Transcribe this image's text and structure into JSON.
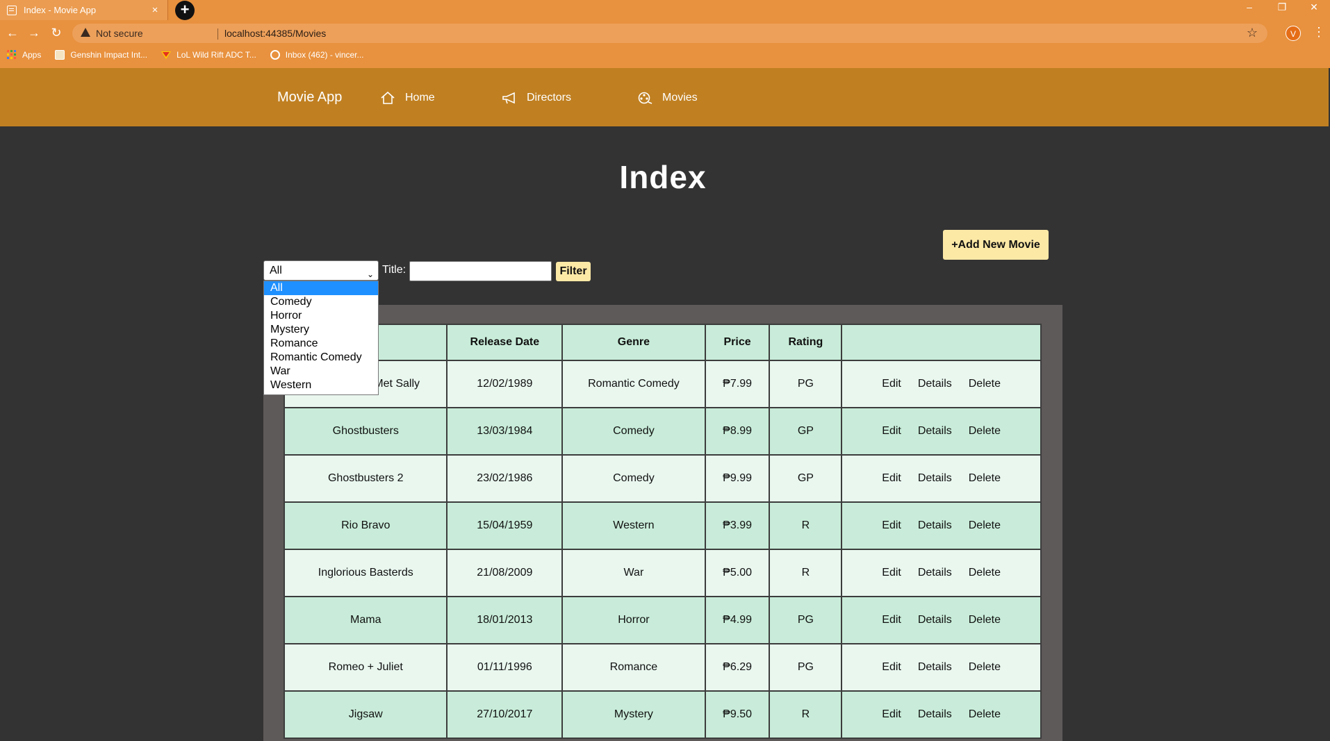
{
  "browser": {
    "tab_title": "Index - Movie App",
    "tab_close": "×",
    "new_tab": "+",
    "window_controls": [
      "–",
      "❐",
      "✕"
    ],
    "security_label": "Not secure",
    "url": "localhost:44385/Movies",
    "profile_initial": "V",
    "bookmarks": [
      {
        "label": "Apps",
        "icon": "apps-grid-icon"
      },
      {
        "label": "Genshin Impact Int...",
        "icon": "genshin-icon"
      },
      {
        "label": "LoL Wild Rift ADC T...",
        "icon": "wildrift-icon"
      },
      {
        "label": "Inbox (462) - vincer...",
        "icon": "mail-icon"
      }
    ]
  },
  "navbar": {
    "brand": "Movie App",
    "links": [
      {
        "label": "Home",
        "icon": "home-icon"
      },
      {
        "label": "Directors",
        "icon": "megaphone-icon"
      },
      {
        "label": "Movies",
        "icon": "film-reel-icon"
      }
    ]
  },
  "page": {
    "title": "Index",
    "add_button": "+Add New Movie"
  },
  "filter": {
    "selected_genre": "All",
    "title_label": "Title:",
    "title_value": "",
    "button": "Filter",
    "options": [
      "All",
      "Comedy",
      "Horror",
      "Mystery",
      "Romance",
      "Romantic Comedy",
      "War",
      "Western"
    ]
  },
  "table": {
    "headers": [
      "",
      "Release Date",
      "Genre",
      "Price",
      "Rating",
      ""
    ],
    "action_labels": [
      "Edit",
      "Details",
      "Delete"
    ],
    "rows": [
      {
        "title": "When Harry Met Sally",
        "date": "12/02/1989",
        "genre": "Romantic Comedy",
        "price": "₱7.99",
        "rating": "PG"
      },
      {
        "title": "Ghostbusters",
        "date": "13/03/1984",
        "genre": "Comedy",
        "price": "₱8.99",
        "rating": "GP"
      },
      {
        "title": "Ghostbusters 2",
        "date": "23/02/1986",
        "genre": "Comedy",
        "price": "₱9.99",
        "rating": "GP"
      },
      {
        "title": "Rio Bravo",
        "date": "15/04/1959",
        "genre": "Western",
        "price": "₱3.99",
        "rating": "R"
      },
      {
        "title": "Inglorious Basterds",
        "date": "21/08/2009",
        "genre": "War",
        "price": "₱5.00",
        "rating": "R"
      },
      {
        "title": "Mama",
        "date": "18/01/2013",
        "genre": "Horror",
        "price": "₱4.99",
        "rating": "PG"
      },
      {
        "title": "Romeo + Juliet",
        "date": "01/11/1996",
        "genre": "Romance",
        "price": "₱6.29",
        "rating": "PG"
      },
      {
        "title": "Jigsaw",
        "date": "27/10/2017",
        "genre": "Mystery",
        "price": "₱9.50",
        "rating": "R"
      }
    ]
  },
  "colors": {
    "chrome": "#e8913e",
    "navbar": "#c08022",
    "background": "#333333",
    "button": "#fde9a6",
    "row_light": "#e9f7ef",
    "row_dark": "#c8ecd9"
  }
}
